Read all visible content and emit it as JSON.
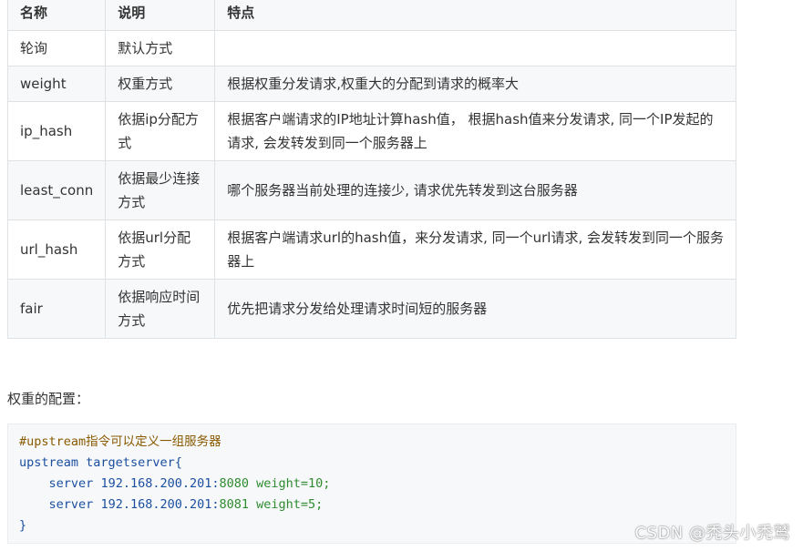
{
  "table": {
    "headers": [
      "名称",
      "说明",
      "特点"
    ],
    "rows": [
      {
        "name": "轮询",
        "desc": "默认方式",
        "feature": ""
      },
      {
        "name": "weight",
        "desc": "权重方式",
        "feature": "根据权重分发请求,权重大的分配到请求的概率大"
      },
      {
        "name": "ip_hash",
        "desc": "依据ip分配方式",
        "feature": "根据客户端请求的IP地址计算hash值， 根据hash值来分发请求, 同一个IP发起的请求, 会发转发到同一个服务器上"
      },
      {
        "name": "least_conn",
        "desc": "依据最少连接方式",
        "feature": "哪个服务器当前处理的连接少, 请求优先转发到这台服务器"
      },
      {
        "name": "url_hash",
        "desc": "依据url分配方式",
        "feature": "根据客户端请求url的hash值，来分发请求, 同一个url请求, 会发转发到同一个服务器上"
      },
      {
        "name": "fair",
        "desc": "依据响应时间方式",
        "feature": "优先把请求分发给处理请求时间短的服务器"
      }
    ]
  },
  "section_label": "权重的配置：",
  "code": {
    "comment": "#upstream指令可以定义一组服务器",
    "upstream_kw": "upstream",
    "upstream_name": "targetserver{",
    "servers": [
      {
        "kw": "server",
        "ip": "192.168.200.201:",
        "port": "8080",
        "param": "weight=10;"
      },
      {
        "kw": "server",
        "ip": "192.168.200.201:",
        "port": "8081",
        "param": "weight=5;"
      }
    ],
    "close": "}"
  },
  "watermark": "CSDN @秃头小秃鹫"
}
